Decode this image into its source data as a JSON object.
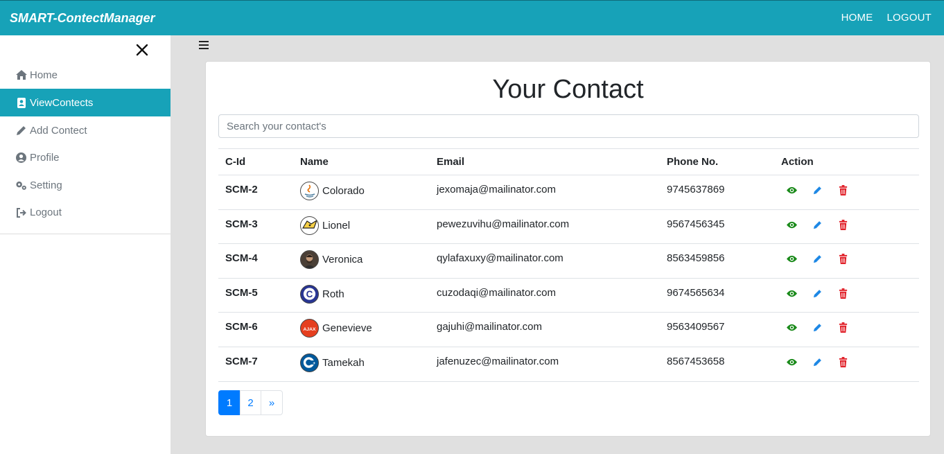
{
  "navbar": {
    "brand": "SMART-ContectManager",
    "links": [
      "HOME",
      "LOGOUT"
    ]
  },
  "sidebar": {
    "items": [
      {
        "label": "Home",
        "icon": "home-icon",
        "active": false
      },
      {
        "label": "ViewContects",
        "icon": "address-book-icon",
        "active": true
      },
      {
        "label": "Add Contect",
        "icon": "pencil-icon",
        "active": false
      },
      {
        "label": "Profile",
        "icon": "user-circle-icon",
        "active": false
      },
      {
        "label": "Setting",
        "icon": "gears-icon",
        "active": false
      },
      {
        "label": "Logout",
        "icon": "sign-out-icon",
        "active": false
      }
    ]
  },
  "main": {
    "title": "Your Contact",
    "search_placeholder": "Search your contact's",
    "columns": [
      "C-Id",
      "Name",
      "Email",
      "Phone No.",
      "Action"
    ],
    "rows": [
      {
        "cid": "SCM-2",
        "name": "Colorado",
        "email": "jexomaja@mailinator.com",
        "phone": "9745637869",
        "avatar": "java-logo"
      },
      {
        "cid": "SCM-3",
        "name": "Lionel",
        "email": "pewezuvihu@mailinator.com",
        "phone": "9567456345",
        "avatar": "tomcat-logo"
      },
      {
        "cid": "SCM-4",
        "name": "Veronica",
        "email": "qylafaxuxy@mailinator.com",
        "phone": "8563459856",
        "avatar": "person-photo"
      },
      {
        "cid": "SCM-5",
        "name": "Roth",
        "email": "cuzodaqi@mailinator.com",
        "phone": "9674565634",
        "avatar": "c-language-logo"
      },
      {
        "cid": "SCM-6",
        "name": "Genevieve",
        "email": "gajuhi@mailinator.com",
        "phone": "9563409567",
        "avatar": "ajax-logo"
      },
      {
        "cid": "SCM-7",
        "name": "Tamekah",
        "email": "jafenuzec@mailinator.com",
        "phone": "8567453658",
        "avatar": "cpp-logo"
      }
    ],
    "avatar_texts": {
      "ajax": "AJAX",
      "c": "C"
    },
    "pagination": [
      "1",
      "2",
      "»"
    ]
  },
  "colors": {
    "primary": "#17a2b8",
    "view": "#1a8a1a",
    "edit": "#1e88e5",
    "delete": "#e01b24",
    "page_active": "#007bff"
  }
}
